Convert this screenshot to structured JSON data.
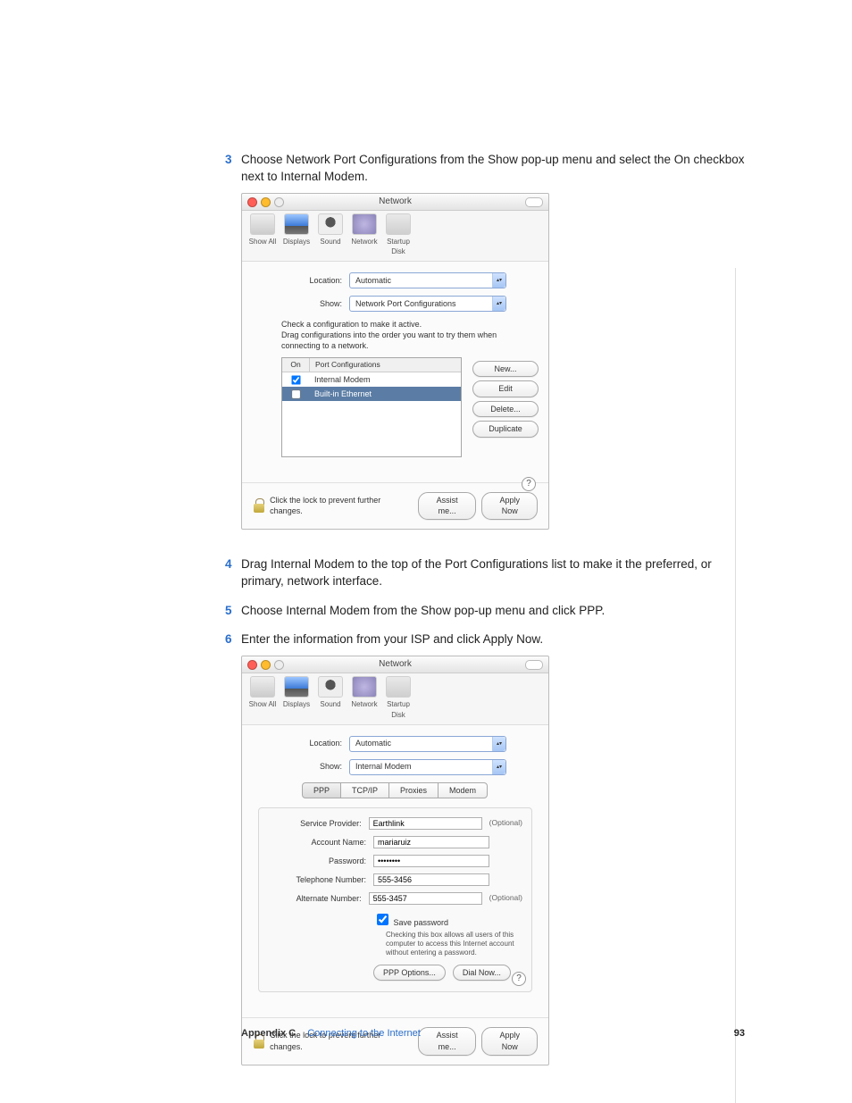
{
  "steps": {
    "s3": "Choose Network Port Configurations from the Show pop-up menu and select the On checkbox next to Internal Modem.",
    "s4": "Drag Internal Modem to the top of the Port Configurations list to make it the preferred, or primary, network interface.",
    "s5": "Choose Internal Modem from the Show pop-up menu and click PPP.",
    "s6": "Enter the information from your ISP and click Apply Now."
  },
  "win": {
    "title": "Network",
    "tb": {
      "showall": "Show All",
      "displays": "Displays",
      "sound": "Sound",
      "network": "Network",
      "disk": "Startup Disk"
    },
    "location_label": "Location:",
    "show_label": "Show:",
    "location_value": "Automatic",
    "lock_text": "Click the lock to prevent further changes.",
    "assist": "Assist me...",
    "apply": "Apply Now",
    "help": "?"
  },
  "shot1": {
    "show_value": "Network Port Configurations",
    "instr": "Check a configuration to make it active.\nDrag configurations into the order you want to try them when connecting to a network.",
    "col_on": "On",
    "col_pc": "Port Configurations",
    "row1": "Internal Modem",
    "row2": "Built-in Ethernet",
    "btn_new": "New...",
    "btn_edit": "Edit",
    "btn_delete": "Delete...",
    "btn_dup": "Duplicate"
  },
  "shot2": {
    "show_value": "Internal Modem",
    "tabs": {
      "ppp": "PPP",
      "tcpip": "TCP/IP",
      "proxies": "Proxies",
      "modem": "Modem"
    },
    "fields": {
      "sp_l": "Service Provider:",
      "sp_v": "Earthlink",
      "sp_o": "(Optional)",
      "an_l": "Account Name:",
      "an_v": "mariaruiz",
      "pw_l": "Password:",
      "pw_v": "••••••••",
      "tn_l": "Telephone Number:",
      "tn_v": "555-3456",
      "alt_l": "Alternate Number:",
      "alt_v": "555-3457",
      "alt_o": "(Optional)",
      "save": "Save password",
      "hint": "Checking this box allows all users of this computer to access this Internet account without entering a password.",
      "pppopt": "PPP Options...",
      "dial": "Dial Now..."
    }
  },
  "footer": {
    "appendix": "Appendix C",
    "title": "Connecting to the Internet",
    "page": "93"
  }
}
